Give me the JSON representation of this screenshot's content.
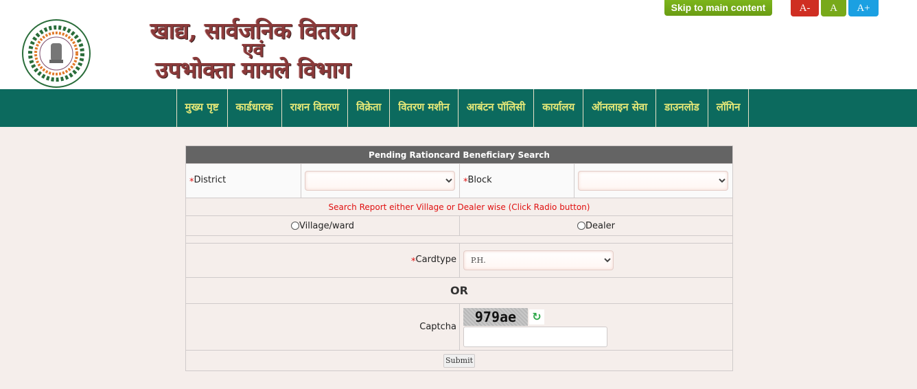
{
  "header": {
    "logo_alt": "Government of Jharkhand emblem",
    "title_line1": "खाद्य, सार्वजनिक वितरण",
    "title_line2": "एवं",
    "title_line3": "उपभोक्ता मामले विभाग",
    "skip_link": "Skip to main content",
    "font_controls": {
      "decrease": "A-",
      "normal": "A",
      "increase": "A+"
    },
    "colors": {
      "skip": "#72a817",
      "decrease": "#cf2e22",
      "normal": "#78a91a",
      "increase": "#1ba0e2"
    }
  },
  "nav": {
    "items": [
      {
        "label": "मुख्य पृष्ट"
      },
      {
        "label": "कार्डधारक"
      },
      {
        "label": "राशन वितरण"
      },
      {
        "label": "विक्रेता"
      },
      {
        "label": "वितरण मशीन"
      },
      {
        "label": "आबंटन पॉलिसी"
      },
      {
        "label": "कार्यालय"
      },
      {
        "label": "ऑनलाइन सेवा"
      },
      {
        "label": "डाउनलोड"
      },
      {
        "label": "लॉगिन"
      }
    ],
    "bg_color": "#0c6a5e",
    "text_color": "#e7e978"
  },
  "form": {
    "title": "Pending Rationcard Beneficiary Search",
    "required_marker": "*",
    "district_label": "District",
    "district_value": "",
    "block_label": "Block",
    "block_value": "",
    "instruction": "Search Report either Village or Dealer wise (Click Radio button)",
    "radio_village": "Village/ward",
    "radio_dealer": "Dealer",
    "cardtype_label": "Cardtype",
    "cardtype_value": "P.H.",
    "or_text": "OR",
    "captcha_label": "Captcha",
    "captcha_text": "979ae",
    "captcha_input_value": "",
    "refresh_icon": "↻",
    "submit_label": "Submit"
  }
}
